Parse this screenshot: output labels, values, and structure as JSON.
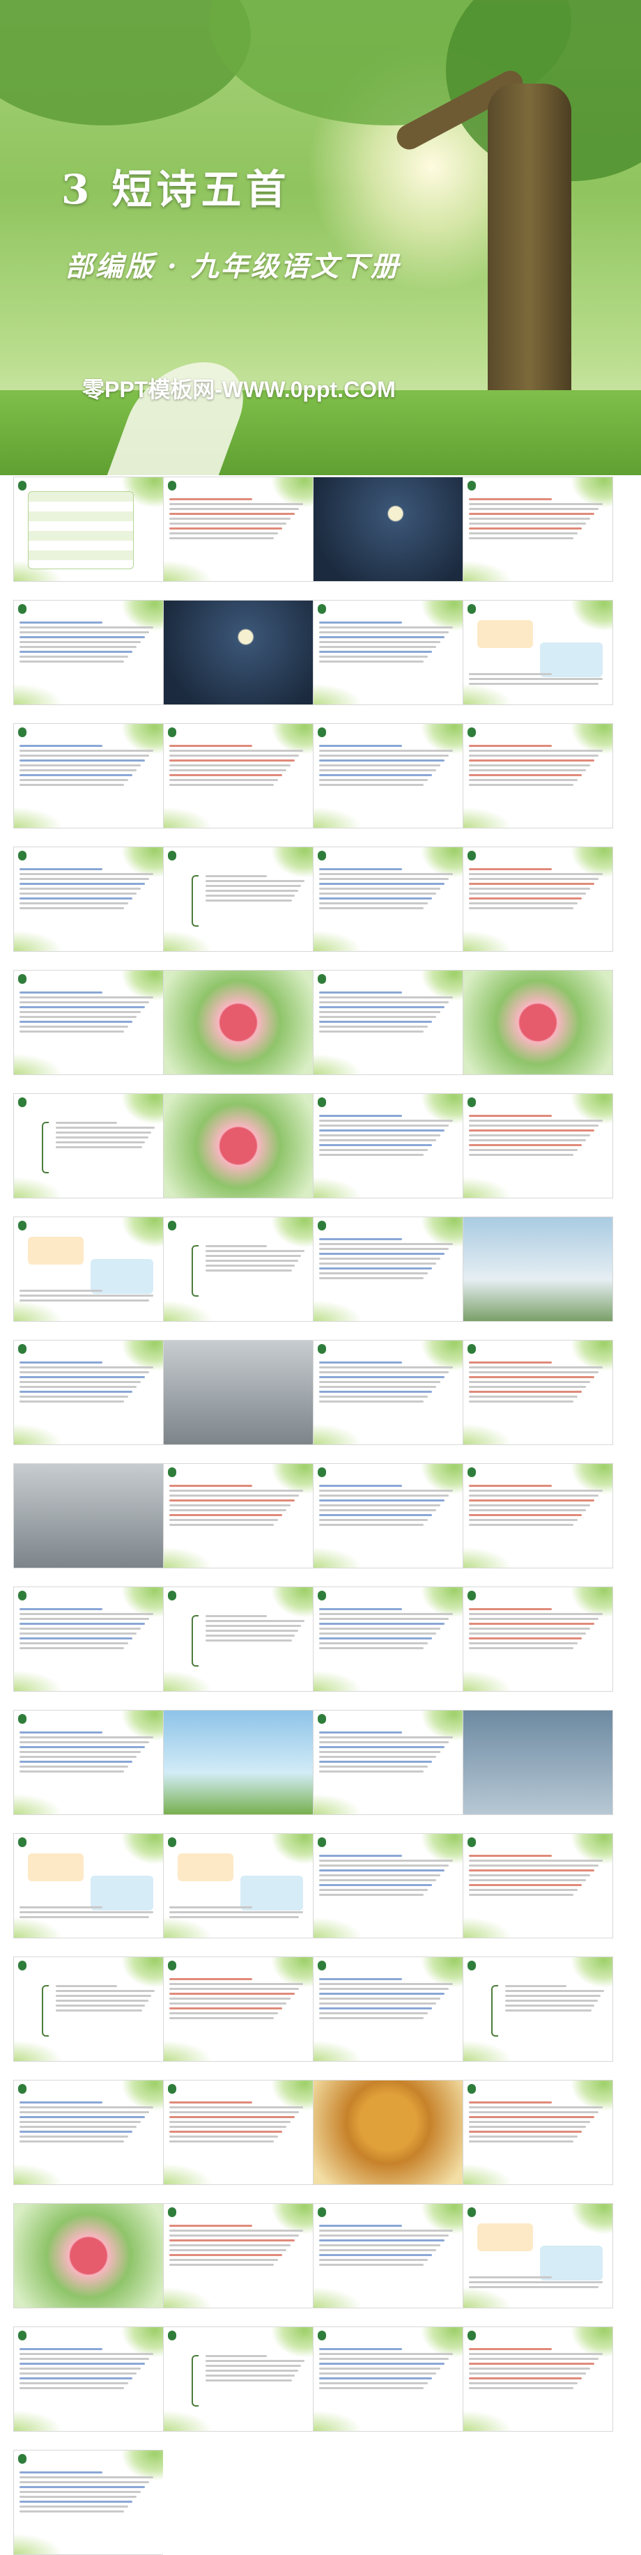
{
  "cover": {
    "title": "3 短诗五首",
    "subtitle": "部编版 · 九年级语文下册",
    "site": "零PPT模板网-WWW.0ppt.COM"
  },
  "slides": [
    {
      "id": 1,
      "kind": "table"
    },
    {
      "id": 2,
      "kind": "text"
    },
    {
      "id": 3,
      "kind": "photo-dark"
    },
    {
      "id": 4,
      "kind": "text"
    },
    {
      "id": 5,
      "kind": "text"
    },
    {
      "id": 6,
      "kind": "photo-dark"
    },
    {
      "id": 7,
      "kind": "text"
    },
    {
      "id": 8,
      "kind": "boxes"
    },
    {
      "id": 9,
      "kind": "text"
    },
    {
      "id": 10,
      "kind": "text"
    },
    {
      "id": 11,
      "kind": "text"
    },
    {
      "id": 12,
      "kind": "text"
    },
    {
      "id": 13,
      "kind": "text"
    },
    {
      "id": 14,
      "kind": "diagram"
    },
    {
      "id": 15,
      "kind": "text"
    },
    {
      "id": 16,
      "kind": "text"
    },
    {
      "id": 17,
      "kind": "text"
    },
    {
      "id": 18,
      "kind": "photo-flower"
    },
    {
      "id": 19,
      "kind": "text"
    },
    {
      "id": 20,
      "kind": "photo-flower"
    },
    {
      "id": 21,
      "kind": "diagram"
    },
    {
      "id": 22,
      "kind": "photo-flower"
    },
    {
      "id": 23,
      "kind": "text"
    },
    {
      "id": 24,
      "kind": "text"
    },
    {
      "id": 25,
      "kind": "boxes"
    },
    {
      "id": 26,
      "kind": "diagram"
    },
    {
      "id": 27,
      "kind": "text"
    },
    {
      "id": 28,
      "kind": "photo-painting"
    },
    {
      "id": 29,
      "kind": "text"
    },
    {
      "id": 30,
      "kind": "photo-grey"
    },
    {
      "id": 31,
      "kind": "text"
    },
    {
      "id": 32,
      "kind": "text"
    },
    {
      "id": 33,
      "kind": "photo-grey"
    },
    {
      "id": 34,
      "kind": "text"
    },
    {
      "id": 35,
      "kind": "text"
    },
    {
      "id": 36,
      "kind": "text"
    },
    {
      "id": 37,
      "kind": "text"
    },
    {
      "id": 38,
      "kind": "diagram"
    },
    {
      "id": 39,
      "kind": "text"
    },
    {
      "id": 40,
      "kind": "text"
    },
    {
      "id": 41,
      "kind": "text"
    },
    {
      "id": 42,
      "kind": "photo-sky"
    },
    {
      "id": 43,
      "kind": "text"
    },
    {
      "id": 44,
      "kind": "photo-rain"
    },
    {
      "id": 45,
      "kind": "boxes"
    },
    {
      "id": 46,
      "kind": "boxes"
    },
    {
      "id": 47,
      "kind": "text"
    },
    {
      "id": 48,
      "kind": "text"
    },
    {
      "id": 49,
      "kind": "diagram"
    },
    {
      "id": 50,
      "kind": "text"
    },
    {
      "id": 51,
      "kind": "text"
    },
    {
      "id": 52,
      "kind": "diagram"
    },
    {
      "id": 53,
      "kind": "text"
    },
    {
      "id": 54,
      "kind": "text"
    },
    {
      "id": 55,
      "kind": "photo-tree"
    },
    {
      "id": 56,
      "kind": "text"
    },
    {
      "id": 57,
      "kind": "photo-flower"
    },
    {
      "id": 58,
      "kind": "text"
    },
    {
      "id": 59,
      "kind": "text"
    },
    {
      "id": 60,
      "kind": "boxes"
    },
    {
      "id": 61,
      "kind": "text"
    },
    {
      "id": 62,
      "kind": "diagram"
    },
    {
      "id": 63,
      "kind": "text"
    },
    {
      "id": 64,
      "kind": "text"
    },
    {
      "id": 65,
      "kind": "text"
    },
    {
      "id": 66,
      "kind": "blank"
    }
  ],
  "palette": {
    "accent": "#2f7d3a",
    "leaf": "#9ed06a",
    "dark": "#233a57",
    "rose": "#e08a7a",
    "blue": "#8aa7d6"
  }
}
